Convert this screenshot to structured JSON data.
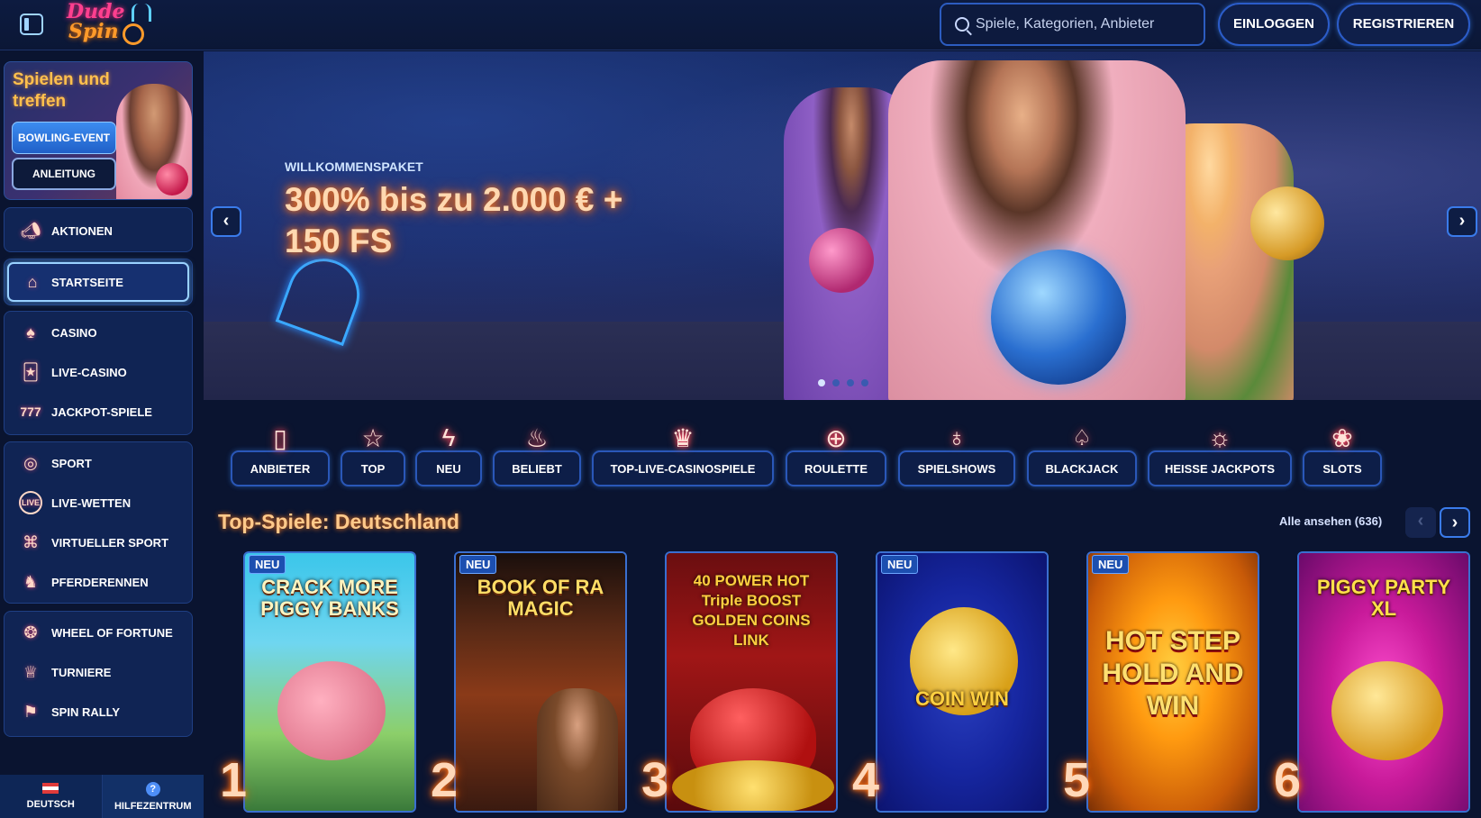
{
  "header": {
    "logo_line1": "Dude",
    "logo_line2": "Spin",
    "search_placeholder": "Spiele, Kategorien, Anbieter",
    "login_label": "EINLOGGEN",
    "register_label": "REGISTRIEREN"
  },
  "sidebar": {
    "promo": {
      "title": "Spielen und treffen",
      "event_button": "BOWLING-EVENT",
      "guide_button": "ANLEITUNG"
    },
    "items": [
      {
        "label": "AKTIONEN",
        "icon": "megaphone-icon"
      },
      {
        "label": "STARTSEITE",
        "icon": "home-icon",
        "active": true
      },
      {
        "label": "CASINO",
        "icon": "spade-icon"
      },
      {
        "label": "LIVE-CASINO",
        "icon": "cards-icon"
      },
      {
        "label": "JACKPOT-SPIELE",
        "icon": "jackpot-777-icon"
      },
      {
        "label": "SPORT",
        "icon": "ball-icon"
      },
      {
        "label": "LIVE-WETTEN",
        "icon": "live-icon"
      },
      {
        "label": "VIRTUELLER SPORT",
        "icon": "gamepad-icon"
      },
      {
        "label": "PFERDERENNEN",
        "icon": "horse-icon"
      },
      {
        "label": "WHEEL OF FORTUNE",
        "icon": "wheel-icon"
      },
      {
        "label": "TURNIERE",
        "icon": "trophy-icon"
      },
      {
        "label": "SPIN RALLY",
        "icon": "flag-icon"
      }
    ],
    "footer": {
      "language": "DEUTSCH",
      "help": "HILFEZENTRUM"
    }
  },
  "hero": {
    "kicker": "WILLKOMMENSPAKET",
    "title": "300% bis zu 2.000 € + 150 FS",
    "slide_count": 4,
    "active_slide": 1
  },
  "categories": [
    {
      "label": "ANBIETER",
      "icon": "book-icon"
    },
    {
      "label": "TOP",
      "icon": "star-icon"
    },
    {
      "label": "NEU",
      "icon": "lightning-icon"
    },
    {
      "label": "BELIEBT",
      "icon": "flame-icon"
    },
    {
      "label": "TOP-LIVE-CASINOSPIELE",
      "icon": "crown-icon"
    },
    {
      "label": "ROULETTE",
      "icon": "roulette-icon"
    },
    {
      "label": "SPIELSHOWS",
      "icon": "microphone-icon"
    },
    {
      "label": "BLACKJACK",
      "icon": "playing-cards-icon"
    },
    {
      "label": "HEISSE JACKPOTS",
      "icon": "hot-jackpot-icon"
    },
    {
      "label": "SLOTS",
      "icon": "cherry-icon"
    }
  ],
  "top_games": {
    "title": "Top-Spiele: Deutschland",
    "see_all": "Alle ansehen (636)",
    "new_badge": "NEU",
    "games": [
      {
        "rank": "1",
        "name": "CRACK MORE PIGGY BANKS",
        "new": true
      },
      {
        "rank": "2",
        "name": "BOOK OF RA MAGIC",
        "new": true
      },
      {
        "rank": "3",
        "name": "40 POWER HOT Triple BOOST GOLDEN COINS LINK",
        "new": false
      },
      {
        "rank": "4",
        "name": "COIN WIN",
        "new": true
      },
      {
        "rank": "5",
        "name": "HOT STEP HOLD AND WIN",
        "new": true
      },
      {
        "rank": "6",
        "name": "PIGGY PARTY XL",
        "new": false
      }
    ]
  },
  "colors": {
    "background": "#0a1430",
    "accent_blue": "#2b5cc9",
    "neon_orange": "#ff7a1a",
    "neon_pink": "#ff3f8f"
  }
}
